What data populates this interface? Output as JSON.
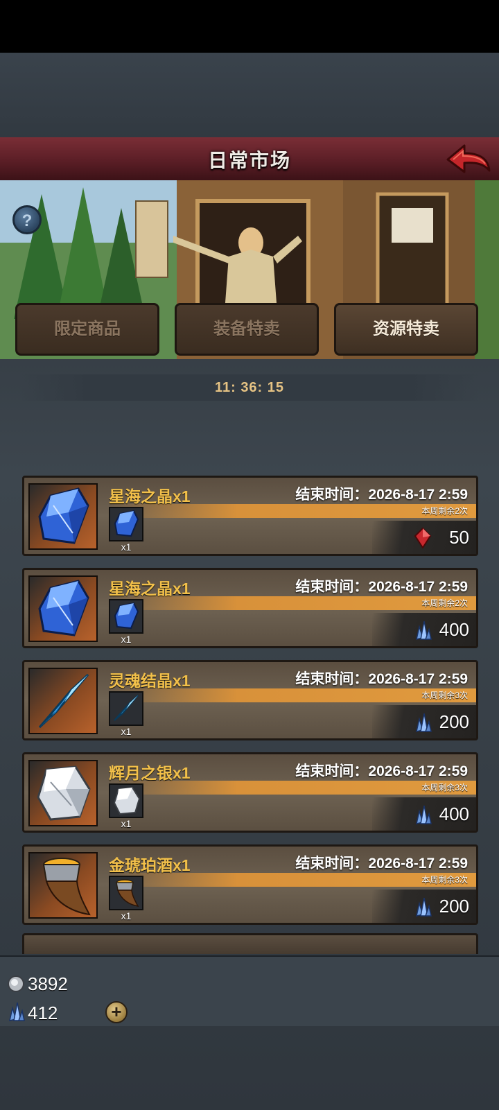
{
  "header": {
    "title": "日常市场"
  },
  "tabs": [
    {
      "label": "限定商品",
      "active": false
    },
    {
      "label": "装备特卖",
      "active": false
    },
    {
      "label": "资源特卖",
      "active": true
    }
  ],
  "timer": "11: 36: 15",
  "offers": [
    {
      "name": "星海之晶x1",
      "end_time": "结束时间：2026-8-17 2:59",
      "remaining": "本周剩余2次",
      "qty": "x1",
      "price": "50",
      "currency_icon": "ruby-icon",
      "item_icon": "blue-crystal-icon"
    },
    {
      "name": "星海之晶x1",
      "end_time": "结束时间：2026-8-17 2:59",
      "remaining": "本周剩余2次",
      "qty": "x1",
      "price": "400",
      "currency_icon": "crystal-cluster-icon",
      "item_icon": "blue-crystal-icon"
    },
    {
      "name": "灵魂结晶x1",
      "end_time": "结束时间：2026-8-17 2:59",
      "remaining": "本周剩余3次",
      "qty": "x1",
      "price": "200",
      "currency_icon": "crystal-cluster-icon",
      "item_icon": "soul-crystal-icon"
    },
    {
      "name": "辉月之银x1",
      "end_time": "结束时间：2026-8-17 2:59",
      "remaining": "本周剩余3次",
      "qty": "x1",
      "price": "400",
      "currency_icon": "crystal-cluster-icon",
      "item_icon": "silver-ore-icon"
    },
    {
      "name": "金琥珀酒x1",
      "end_time": "结束时间：2026-8-17 2:59",
      "remaining": "本周剩余3次",
      "qty": "x1",
      "price": "200",
      "currency_icon": "crystal-cluster-icon",
      "item_icon": "amber-horn-icon"
    }
  ],
  "resources": {
    "silver": "3892",
    "crystals": "412"
  },
  "colors": {
    "title_bar": "#5b1e26",
    "item_name": "#f2c04a",
    "remain_strip": "#d8913a"
  }
}
